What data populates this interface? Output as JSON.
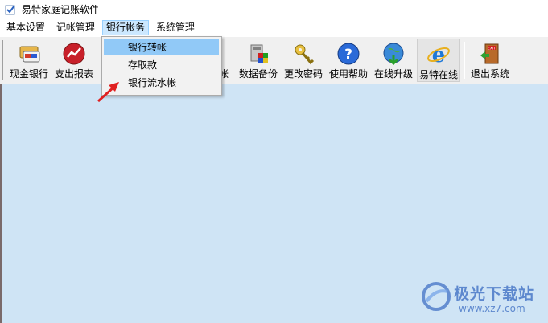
{
  "window": {
    "title": "易特家庭记账软件",
    "icon": "app-checkmark-icon"
  },
  "menubar": {
    "items": [
      {
        "label": "基本设置"
      },
      {
        "label": "记帐管理"
      },
      {
        "label": "银行帐务",
        "active": true
      },
      {
        "label": "系统管理"
      }
    ]
  },
  "dropdown": {
    "items": [
      {
        "label": "银行转帐",
        "highlighted": true
      },
      {
        "label": "存取款"
      },
      {
        "label": "银行流水帐"
      }
    ]
  },
  "toolbar": {
    "buttons": [
      {
        "label": "现金银行",
        "icon": "cash-bank-icon"
      },
      {
        "label": "支出报表",
        "icon": "expense-report-icon"
      },
      {
        "label": "帐",
        "icon": "account-icon"
      },
      {
        "label": "数据备份",
        "icon": "data-backup-icon"
      },
      {
        "label": "更改密码",
        "icon": "key-icon"
      },
      {
        "label": "使用帮助",
        "icon": "help-icon"
      },
      {
        "label": "在线升级",
        "icon": "online-upgrade-icon"
      },
      {
        "label": "易特在线",
        "icon": "ie-browser-icon"
      },
      {
        "label": "退出系统",
        "icon": "exit-door-icon"
      }
    ]
  },
  "watermark": {
    "text": "极光下载站",
    "url": "www.xz7.com"
  },
  "colors": {
    "workspace": "#cfe4f5",
    "menu_highlight": "#91c9f7",
    "arrow": "#e02020"
  }
}
